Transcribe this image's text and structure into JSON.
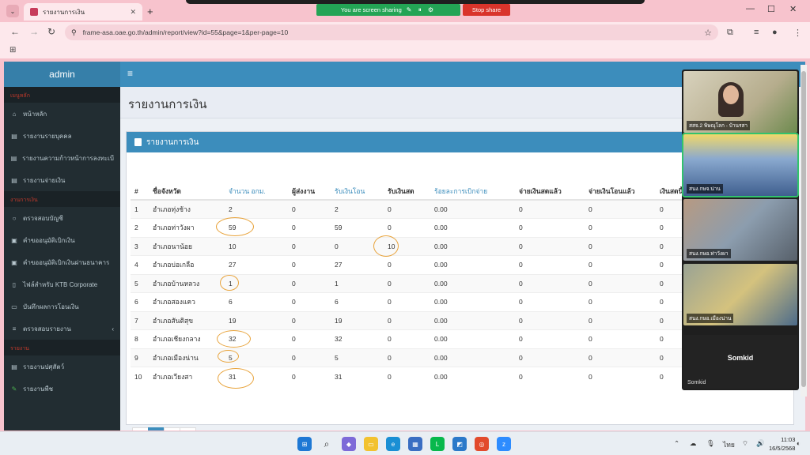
{
  "screen_share": {
    "status": "You are screen sharing",
    "stop_label": "Stop share"
  },
  "browser": {
    "tab_title": "รายงานการเงิน",
    "url": "frame-asa.oae.go.th/admin/report/view?id=55&page=1&per-page=10",
    "tab_search_icon": "chevron-down-icon",
    "new_tab_icon": "plus-icon"
  },
  "app": {
    "brand": "admin"
  },
  "sidebar": {
    "sections": [
      {
        "header": "เมนูหลัก",
        "items": [
          {
            "label": "หน้าหลัก",
            "icon": "home-icon"
          },
          {
            "label": "รายงานรายบุคคล",
            "icon": "document-icon"
          },
          {
            "label": "รายงานความก้าวหน้าการลงทะเบี",
            "icon": "document-icon"
          },
          {
            "label": "รายงานจ่ายเงิน",
            "icon": "document-icon"
          }
        ]
      },
      {
        "header": "งานการเงิน",
        "items": [
          {
            "label": "ตรวจสอบบัญชี",
            "icon": "refresh-icon"
          },
          {
            "label": "คำขออนุมัติเบิกเงิน",
            "icon": "money-icon"
          },
          {
            "label": "คำขออนุมัติเบิกเงินผ่านธนาคาร",
            "icon": "money-icon"
          },
          {
            "label": "ไฟล์สำหรับ KTB Corporate",
            "icon": "file-icon"
          },
          {
            "label": "บันทึกผลการโอนเงิน",
            "icon": "edit-icon"
          },
          {
            "label": "ตรวจสอบรายงาน",
            "icon": "list-icon"
          }
        ]
      },
      {
        "header": "รายงาน",
        "items": [
          {
            "label": "รายงานปศุสัตว์",
            "icon": "document-icon"
          },
          {
            "label": "รายงานพืช",
            "icon": "leaf-icon"
          }
        ]
      }
    ]
  },
  "content": {
    "page_title": "รายงานการเงิน",
    "box_title": "รายงานการเงิน",
    "table": {
      "headers": [
        "#",
        "ชื่อจังหวัด",
        "จำนวน อกม.",
        "ผู้ส่งงาน",
        "รับเงินโอน",
        "รับเงินสด",
        "ร้อยละการเบิกจ่าย",
        "จ่ายเงินสดแล้ว",
        "จ่ายเงินโอนแล้ว",
        "เงินสดนี้"
      ],
      "rows": [
        [
          "1",
          "อำเภอทุ่งช้าง",
          "2",
          "0",
          "2",
          "0",
          "0.00",
          "0",
          "0",
          "0"
        ],
        [
          "2",
          "อำเภอท่าวังผา",
          "59",
          "0",
          "59",
          "0",
          "0.00",
          "0",
          "0",
          "0"
        ],
        [
          "3",
          "อำเภอนาน้อย",
          "10",
          "0",
          "0",
          "10",
          "0.00",
          "0",
          "0",
          "0"
        ],
        [
          "4",
          "อำเภอบ่อเกลือ",
          "27",
          "0",
          "27",
          "0",
          "0.00",
          "0",
          "0",
          "0"
        ],
        [
          "5",
          "อำเภอบ้านหลวง",
          "1",
          "0",
          "1",
          "0",
          "0.00",
          "0",
          "0",
          "0"
        ],
        [
          "6",
          "อำเภอสองแคว",
          "6",
          "0",
          "6",
          "0",
          "0.00",
          "0",
          "0",
          "0"
        ],
        [
          "7",
          "อำเภอสันติสุข",
          "19",
          "0",
          "19",
          "0",
          "0.00",
          "0",
          "0",
          "0"
        ],
        [
          "8",
          "อำเภอเชียงกลาง",
          "32",
          "0",
          "32",
          "0",
          "0.00",
          "0",
          "0",
          "0"
        ],
        [
          "9",
          "อำเภอเมืองน่าน",
          "5",
          "0",
          "5",
          "0",
          "0.00",
          "0",
          "0",
          "0"
        ],
        [
          "10",
          "อำเภอเวียงสา",
          "31",
          "0",
          "31",
          "0",
          "0.00",
          "0",
          "0",
          "0"
        ]
      ]
    },
    "pagination": [
      "«",
      "1",
      "2",
      "»"
    ],
    "pagination_active": "1"
  },
  "zoom": {
    "participants": [
      {
        "name": "สสจ.2 พิษณุโลก - บ้านรสา",
        "bg": "#c9c2a8"
      },
      {
        "name": "สนง.กษจ.น่าน",
        "bg": "#6f8fb5"
      },
      {
        "name": "สนง.กษอ.ท่าวังผา",
        "bg": "#a9876f"
      },
      {
        "name": "สนง.กษอ.เมืองน่าน",
        "bg": "#7f8f7a"
      }
    ],
    "main_name": "Somkid",
    "main_label": "Somkid"
  },
  "taskbar": {
    "time": "11:03",
    "date": "16/5/2568",
    "lang": "ไทย"
  },
  "colors": {
    "primary": "#3c8dbc",
    "sidebar": "#222d32",
    "annotation": "#e8a33b",
    "browser_frame": "#f7c3cd"
  }
}
